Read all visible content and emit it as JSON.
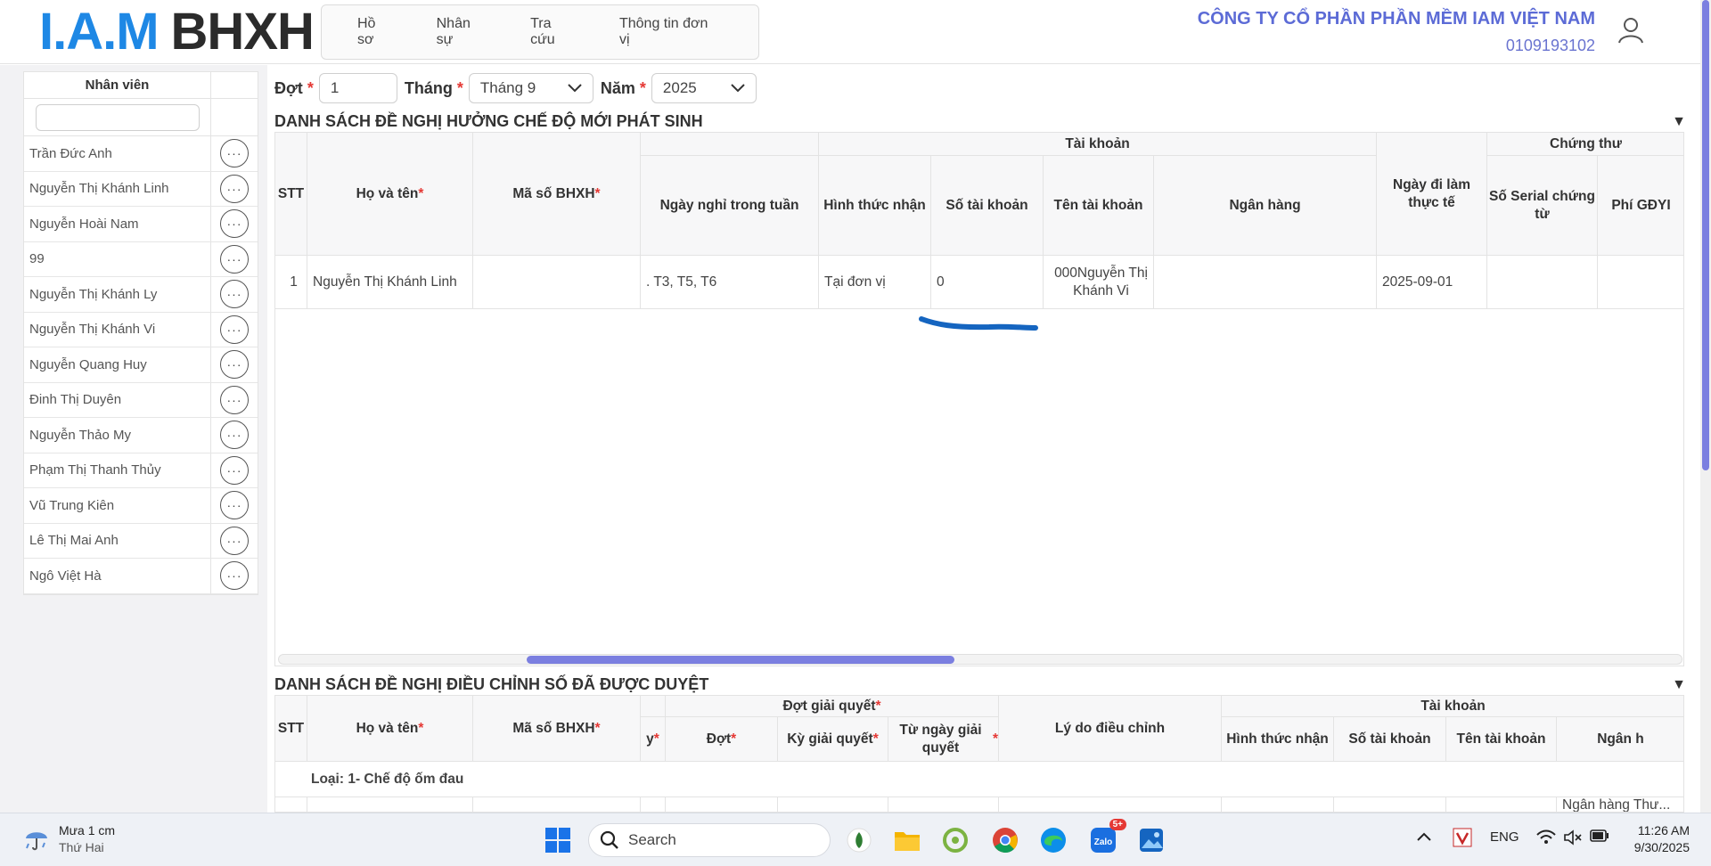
{
  "header": {
    "logo_iam": "I.A.M",
    "logo_bhxh": "BHXH",
    "nav": [
      "Hồ sơ",
      "Nhân sự",
      "Tra cứu",
      "Thông tin đơn vị"
    ],
    "company_name": "CÔNG TY CỔ PHẦN PHẦN MỀM IAM VIỆT NAM",
    "company_code": "0109193102"
  },
  "employees": {
    "header": "Nhân viên",
    "search_value": "",
    "items": [
      "Trần Đức Anh",
      "Nguyễn Thị Khánh Linh",
      "Nguyễn Hoài Nam",
      "99",
      "Nguyễn Thị Khánh Ly",
      "Nguyễn Thị Khánh Vi",
      "Nguyễn Quang Huy",
      "Đinh Thị Duyên",
      "Nguyễn Thảo My",
      "Phạm Thị Thanh Thủy",
      "Vũ Trung Kiên",
      "Lê Thị Mai Anh",
      "Ngô Việt Hà"
    ],
    "more_label": "···"
  },
  "filter": {
    "dot_label": "Đợt",
    "dot_value": "1",
    "thang_label": "Tháng",
    "thang_value": "Tháng 9",
    "nam_label": "Năm",
    "nam_value": "2025",
    "required_mark": "*"
  },
  "section1": {
    "title": "DANH SÁCH ĐỀ NGHỊ HƯỞNG CHẾ ĐỘ MỚI PHÁT SINH",
    "headers": {
      "stt": "STT",
      "ho_ten": "Họ và tên",
      "ma_so": "Mã số BHXH",
      "ngay_nghi": "Ngày nghỉ trong tuần",
      "tai_khoan_group": "Tài khoản",
      "hinh_thuc": "Hình thức nhận",
      "so_tk": "Số tài khoản",
      "ten_tk": "Tên tài khoản",
      "ngan_hang": "Ngân hàng",
      "ngay_di_lam": "Ngày đi làm thực tế",
      "chung_thu_group": "Chứng thư",
      "so_serial": "Số Serial chứng từ",
      "phi": "Phí GĐYI"
    },
    "row": {
      "stt": "1",
      "ho_ten": "Nguyễn Thị Khánh Linh",
      "ma_so": "",
      "ngay_nghi": ". T3, T5, T6",
      "hinh_thuc": "Tại đơn vị",
      "so_tk": "0",
      "ten_tk": "000Nguyễn Thị Khánh Vi",
      "ngan_hang": "",
      "ngay_di_lam": "2025-09-01",
      "so_serial": "",
      "phi": ""
    }
  },
  "section2": {
    "title": "DANH SÁCH ĐỀ NGHỊ ĐIỀU CHỈNH SỐ ĐÃ ĐƯỢC DUYỆT",
    "headers": {
      "stt": "STT",
      "ho_ten": "Họ và tên",
      "ma_so": "Mã số BHXH",
      "partial": "y",
      "dot_group": "Đợt giải quyết",
      "dot": "Đợt",
      "ky": "Kỳ giải quyết",
      "tu_ngay": "Từ ngày giải quyết",
      "ly_do": "Lý do điều chỉnh",
      "tai_khoan_group": "Tài khoản",
      "hinh_thuc": "Hình thức nhận",
      "so_tk": "Số tài khoản",
      "ten_tk": "Tên tài khoản",
      "ngan_hang": "Ngân h"
    },
    "group_row": "Loại: 1- Chế độ ốm đau",
    "partial_bank": "Ngân hàng Thư..."
  },
  "taskbar": {
    "weather_main": "Mưa 1 cm",
    "weather_sub": "Thứ Hai",
    "search_placeholder": "Search",
    "zalo_badge": "5+",
    "lang": "ENG",
    "time": "11:26 AM",
    "date": "9/30/2025"
  },
  "colors": {
    "accent": "#5c6bd6",
    "scroll": "#7b7fe0",
    "required": "#e53935",
    "logo_blue": "#1e88e5"
  }
}
